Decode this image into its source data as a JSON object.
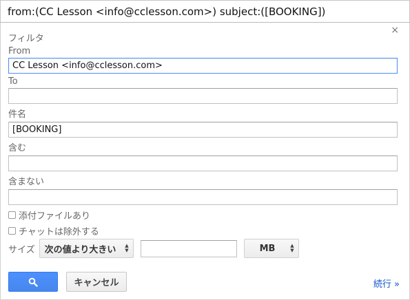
{
  "search_query": "from:(CC Lesson <info@cclesson.com>) subject:([BOOKING])",
  "panel": {
    "title": "フィルタ",
    "close": "×"
  },
  "fields": {
    "from": {
      "label": "From",
      "value": "CC Lesson <info@cclesson.com>"
    },
    "to": {
      "label": "To",
      "value": ""
    },
    "subject": {
      "label": "件名",
      "value": "[BOOKING]"
    },
    "has_words": {
      "label": "含む",
      "value": ""
    },
    "doesnt_have": {
      "label": "含まない",
      "value": ""
    }
  },
  "checkboxes": {
    "has_attachment": {
      "label": "添付ファイルあり",
      "checked": false
    },
    "exclude_chats": {
      "label": "チャットは除外する",
      "checked": false
    }
  },
  "size": {
    "label": "サイズ",
    "operator": "次の値より大きい",
    "value": "",
    "unit": "MB"
  },
  "buttons": {
    "cancel": "キャンセル",
    "continue": "続行 »"
  },
  "colors": {
    "accent": "#4d90fe",
    "link": "#1155cc"
  },
  "icons": {
    "search": "search-icon",
    "close": "close-icon"
  }
}
